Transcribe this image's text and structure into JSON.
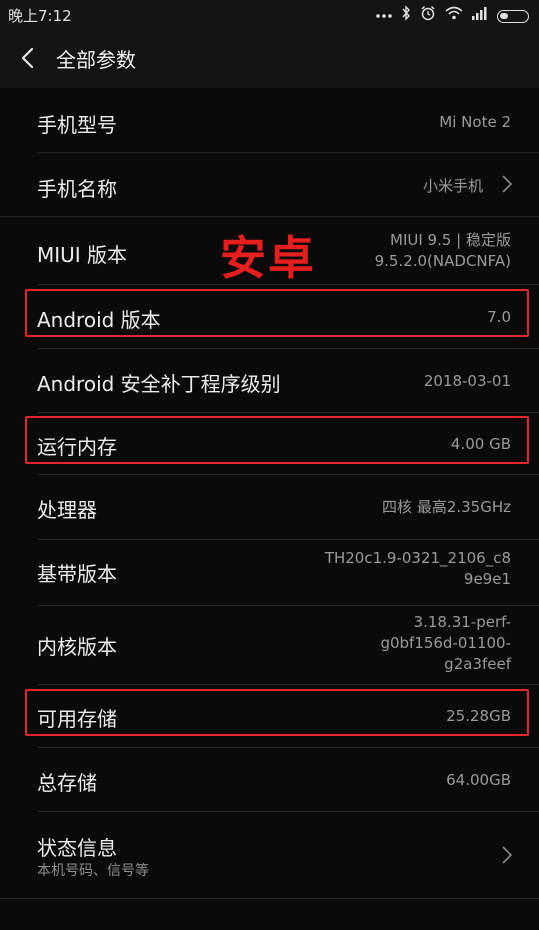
{
  "status_bar": {
    "time": "晚上7:12"
  },
  "header": {
    "title": "全部参数"
  },
  "annotation": {
    "text": "安卓",
    "color": "#e61e1e"
  },
  "rows": [
    {
      "label": "手机型号",
      "value": "Mi Note 2"
    },
    {
      "label": "手机名称",
      "value": "小米手机"
    },
    {
      "label": "MIUI 版本",
      "value_line1": "MIUI 9.5 | 稳定版",
      "value_line2": "9.5.2.0(NADCNFA)"
    },
    {
      "label": "Android 版本",
      "value": "7.0"
    },
    {
      "label": "Android 安全补丁程序级别",
      "value": "2018-03-01"
    },
    {
      "label": "运行内存",
      "value": "4.00 GB"
    },
    {
      "label": "处理器",
      "value": "四核 最高2.35GHz"
    },
    {
      "label": "基带版本",
      "value_line1": "TH20c1.9-0321_2106_c8",
      "value_line2": "9e9e1"
    },
    {
      "label": "内核版本",
      "value_line1": "3.18.31-perf-",
      "value_line2": "g0bf156d-01100-",
      "value_line3": "g2a3feef"
    },
    {
      "label": "可用存储",
      "value": "25.28GB"
    },
    {
      "label": "总存储",
      "value": "64.00GB"
    },
    {
      "label": "状态信息",
      "sublabel": "本机号码、信号等"
    }
  ],
  "colors": {
    "background": "#0a0a0a",
    "highlight_box": "#e5262a",
    "value_text": "#9a9a9a"
  }
}
